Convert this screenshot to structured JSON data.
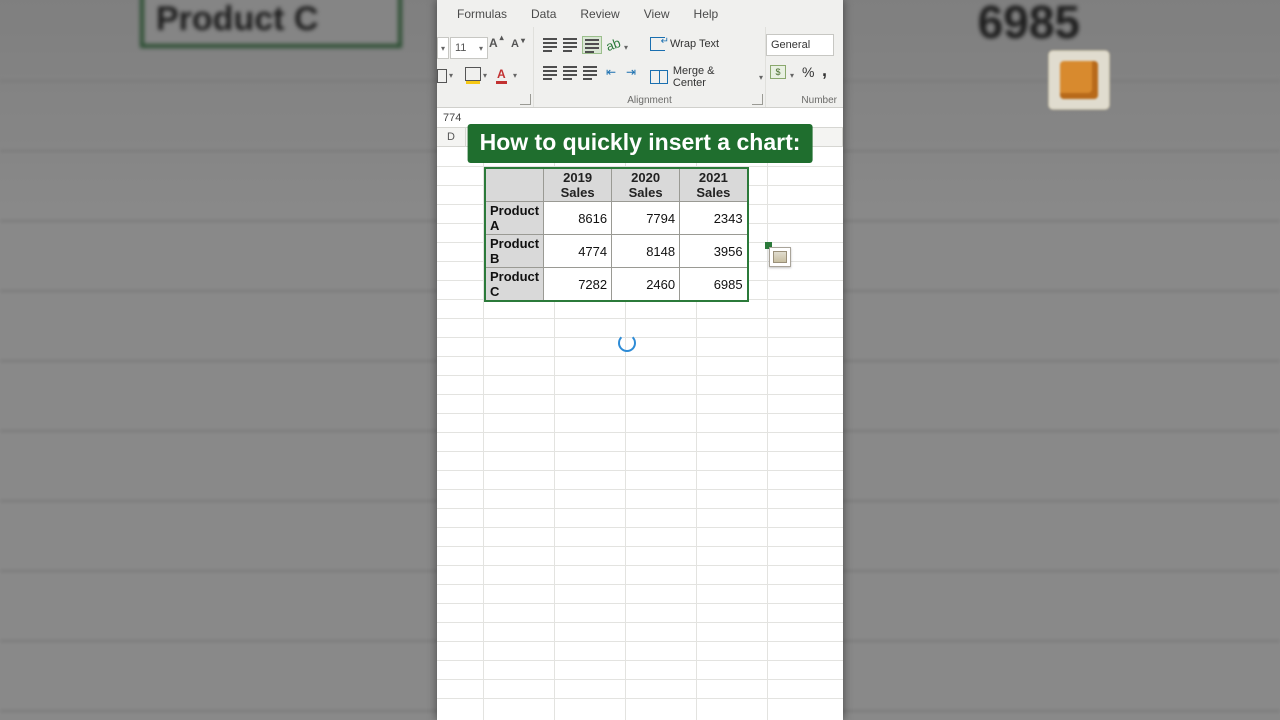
{
  "bg": {
    "cell_label": "Product C",
    "big_number": "6985"
  },
  "ribbon": {
    "tabs": [
      "Formulas",
      "Data",
      "Review",
      "View",
      "Help"
    ],
    "font_size": "11",
    "wrap_label": "Wrap Text",
    "merge_label": "Merge & Center",
    "group_alignment": "Alignment",
    "group_number": "Number",
    "number_format": "General"
  },
  "caption": "How to quickly insert a chart:",
  "formula_bar_value": "774",
  "col_D": "D",
  "table": {
    "corner": "",
    "cols": [
      "2019 Sales",
      "2020 Sales",
      "2021 Sales"
    ],
    "rows": [
      {
        "name": "Product A",
        "vals": [
          "8616",
          "7794",
          "2343"
        ]
      },
      {
        "name": "Product B",
        "vals": [
          "4774",
          "8148",
          "3956"
        ]
      },
      {
        "name": "Product C",
        "vals": [
          "7282",
          "2460",
          "6985"
        ]
      }
    ]
  },
  "percent_glyph": "%",
  "comma_glyph": ","
}
